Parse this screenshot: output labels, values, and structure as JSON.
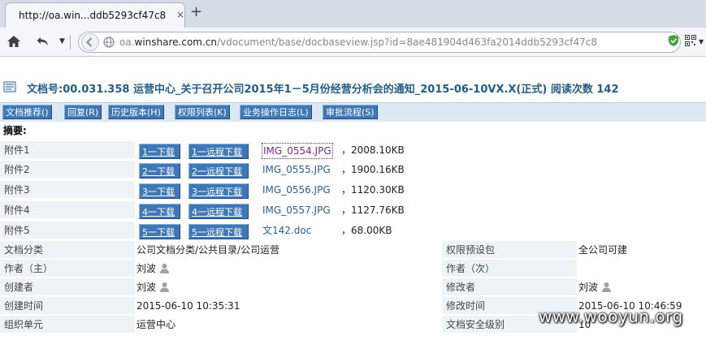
{
  "browser": {
    "tab_title": "http://oa.win...ddb5293cf47c8",
    "tab_close": "×",
    "new_tab": "+",
    "url_prefix": "oa.",
    "url_host": "winshare.com.cn",
    "url_path": "/vdocument/base/docbaseview.jsp?id=8ae481904d463fa2014ddb5293cf47c8"
  },
  "header": {
    "title": "文档号:00.031.358  运营中心_关于召开公司2015年1－5月份经营分析会的通知_2015-06-10VX.X(正式) 阅读次数 142"
  },
  "toolbar": {
    "buttons": [
      "文档推荐()",
      "回复(R)",
      "历史版本(H)",
      "权限列表(K)",
      "业务操作日志(L)",
      "审批流程(S)"
    ]
  },
  "summary_label": "摘要:",
  "attachments": [
    {
      "label": "附件1",
      "download": "1一下载",
      "remote": "1一远程下载",
      "name": "IMG_0554.JPG",
      "size": "，2008.10KB"
    },
    {
      "label": "附件2",
      "download": "2一下载",
      "remote": "2一远程下载",
      "name": "IMG_0555.JPG",
      "size": "，1900.16KB"
    },
    {
      "label": "附件3",
      "download": "3一下载",
      "remote": "3一远程下载",
      "name": "IMG_0556.JPG",
      "size": "，1120.30KB"
    },
    {
      "label": "附件4",
      "download": "4一下载",
      "remote": "4一远程下载",
      "name": "IMG_0557.JPG",
      "size": "，1127.76KB"
    },
    {
      "label": "附件5",
      "download": "5一下载",
      "remote": "5一远程下载",
      "name": "文142.doc",
      "size": "，68.00KB"
    }
  ],
  "fields": {
    "category_label": "文档分类",
    "category_value": "公司文档分类/公共目录/公司运营",
    "permission_label": "权限预设包",
    "permission_value": "全公司可建",
    "author_main_label": "作者（主）",
    "author_main_value": "刘波",
    "author_sub_label": "作者（次）",
    "author_sub_value": "",
    "creator_label": "创建者",
    "creator_value": "刘波",
    "modifier_label": "修改者",
    "modifier_value": "刘波",
    "created_time_label": "创建时间",
    "created_time_value": "2015-06-10 10:35:31",
    "modified_time_label": "修改时间",
    "modified_time_value": "2015-06-10 10:46:59",
    "org_label": "组织单元",
    "org_value": "运营中心",
    "security_label": "文档安全级别",
    "security_value": "10"
  },
  "watermark": "www.wooyun.org",
  "colors": {
    "button_blue": "#3f78b7",
    "title_blue": "#225d88",
    "label_bg": "#eef3f8",
    "link_blue": "#2a5f9a",
    "link_visited": "#7b2a8a"
  }
}
